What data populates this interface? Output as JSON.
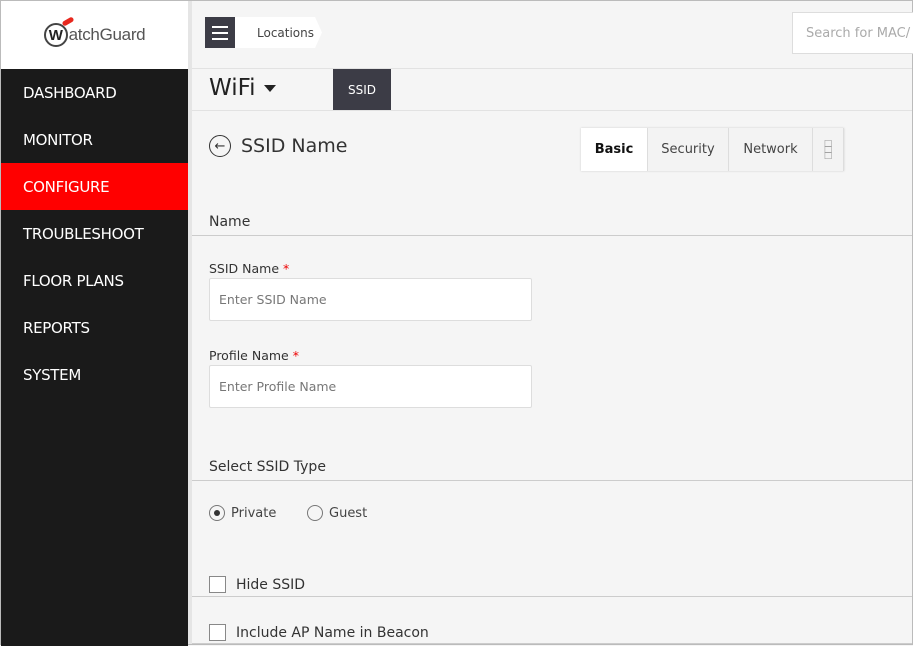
{
  "brand": {
    "logo_text": "WatchGuard",
    "accent": "#ff0000"
  },
  "sidebar": {
    "items": [
      {
        "label": "DASHBOARD"
      },
      {
        "label": "MONITOR"
      },
      {
        "label": "CONFIGURE",
        "active": true
      },
      {
        "label": "TROUBLESHOOT"
      },
      {
        "label": "FLOOR PLANS"
      },
      {
        "label": "REPORTS"
      },
      {
        "label": "SYSTEM"
      }
    ]
  },
  "header": {
    "breadcrumb": "Locations",
    "search_placeholder": "Search for MAC/ IP"
  },
  "subheader": {
    "product": "WiFi",
    "tab": "SSID"
  },
  "page": {
    "title": "SSID Name",
    "tabs": [
      "Basic",
      "Security",
      "Network"
    ],
    "active_tab": "Basic"
  },
  "form": {
    "section_name": "Name",
    "ssid_label": "SSID Name",
    "ssid_placeholder": "Enter SSID Name",
    "profile_label": "Profile Name",
    "profile_placeholder": "Enter Profile Name",
    "required_mark": "*",
    "section_type": "Select SSID Type",
    "types": [
      "Private",
      "Guest"
    ],
    "selected_type": "Private",
    "hide_ssid": "Hide SSID",
    "include_ap": "Include AP Name in Beacon"
  }
}
